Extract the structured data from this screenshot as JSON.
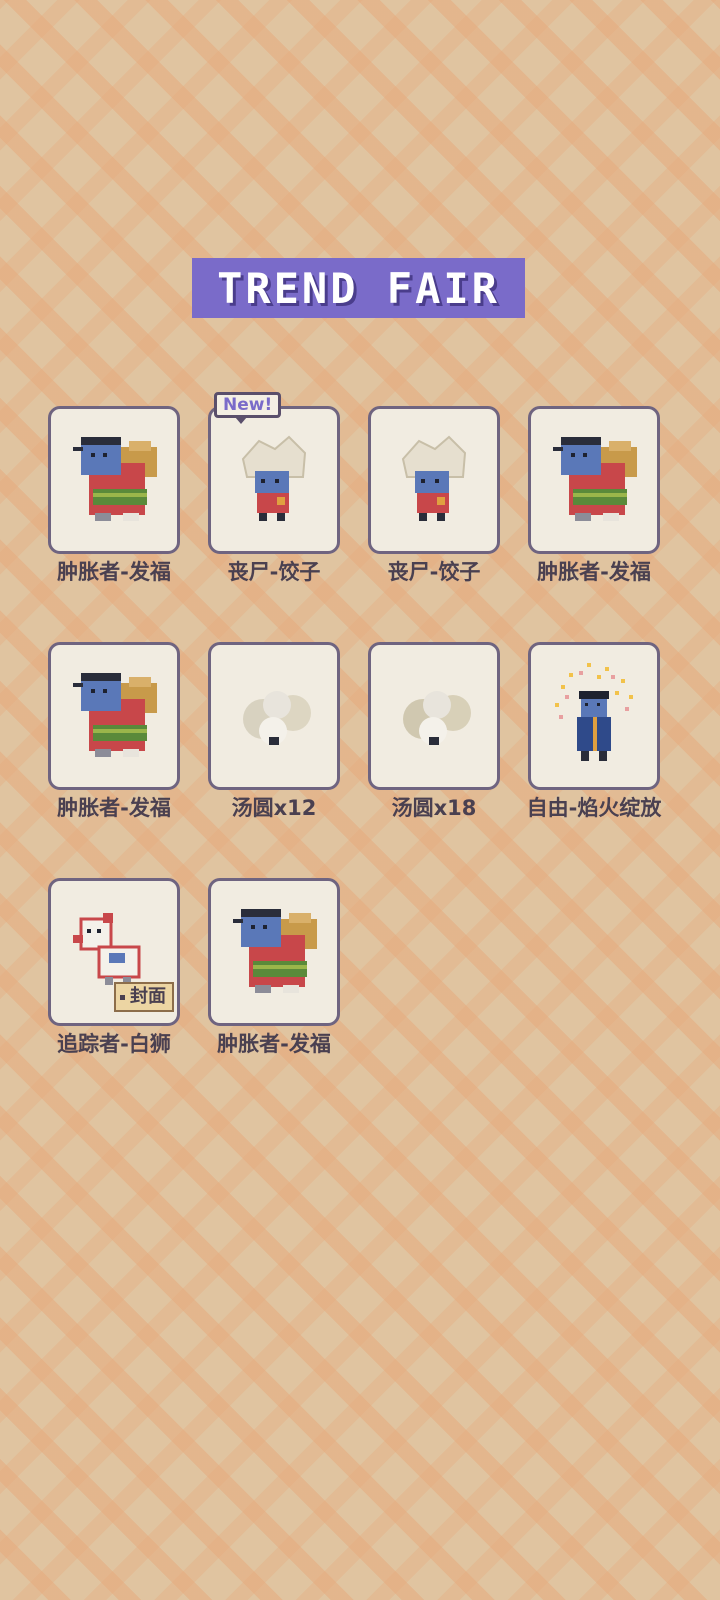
{
  "title": "TREND FAIR",
  "badges": {
    "new": "New!",
    "cover": "封面"
  },
  "items": [
    {
      "label": "肿胀者-发福",
      "sprite": "bloated-fortune"
    },
    {
      "label": "丧尸-饺子",
      "sprite": "zombie-dumpling"
    },
    {
      "label": "丧尸-饺子",
      "sprite": "zombie-dumpling"
    },
    {
      "label": "肿胀者-发福",
      "sprite": "bloated-fortune"
    },
    {
      "label": "肿胀者-发福",
      "sprite": "bloated-fortune"
    },
    {
      "label": "汤圆x12",
      "sprite": "tangyuan"
    },
    {
      "label": "汤圆x18",
      "sprite": "tangyuan"
    },
    {
      "label": "自由-焰火绽放",
      "sprite": "freedom-fireworks"
    },
    {
      "label": "追踪者-白狮",
      "sprite": "tracker-white-lion"
    },
    {
      "label": "肿胀者-发福",
      "sprite": "bloated-fortune"
    }
  ]
}
